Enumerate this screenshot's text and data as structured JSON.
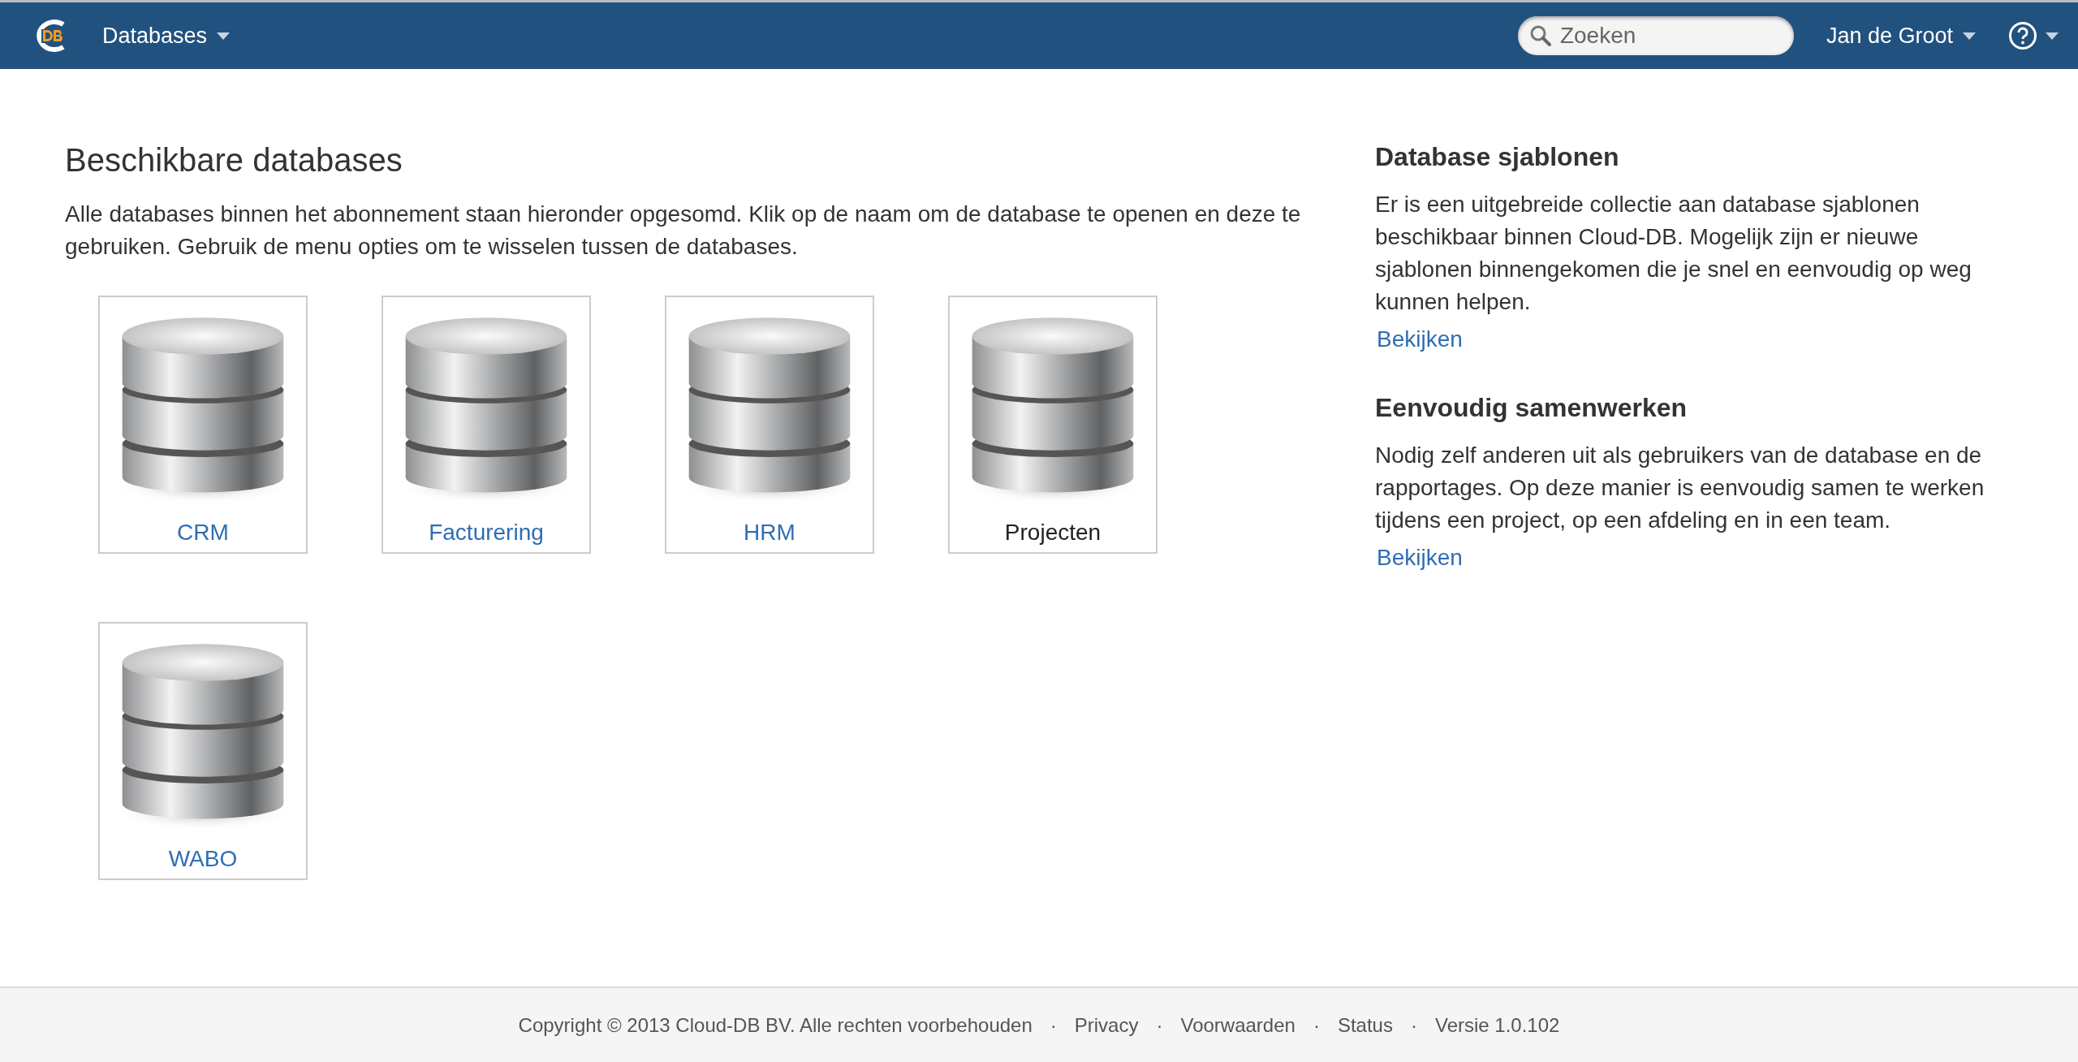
{
  "navbar": {
    "menu": "Databases",
    "search": {
      "placeholder": "Zoeken"
    },
    "user": "Jan de Groot"
  },
  "main": {
    "title": "Beschikbare databases",
    "intro": "Alle databases binnen het abonnement staan hieronder opgesomd. Klik op de naam om de database te openen en deze te gebruiken. Gebruik de menu opties om te wisselen tussen de databases.",
    "databases": [
      {
        "name": "CRM",
        "selected": false
      },
      {
        "name": "Facturering",
        "selected": false
      },
      {
        "name": "HRM",
        "selected": false
      },
      {
        "name": "Projecten",
        "selected": true
      },
      {
        "name": "WABO",
        "selected": false
      }
    ]
  },
  "sidebar": [
    {
      "title": "Database sjablonen",
      "text": "Er is een uitgebreide collectie aan database sjablonen beschikbaar binnen Cloud-DB. Mogelijk zijn er nieuwe sjablonen binnengekomen die je snel en eenvoudig op weg kunnen helpen.",
      "link": "Bekijken"
    },
    {
      "title": "Eenvoudig samenwerken",
      "text": "Nodig zelf anderen uit als gebruikers van de database en de rapportages. Op deze manier is eenvoudig samen te werken tijdens een project, op een afdeling en in een team.",
      "link": "Bekijken"
    }
  ],
  "footer": {
    "copyright": "Copyright © 2013 Cloud-DB BV. Alle rechten voorbehouden",
    "links": [
      "Privacy",
      "Voorwaarden",
      "Status"
    ],
    "separators": [
      "·",
      "·",
      "·",
      "·"
    ],
    "version": "Versie 1.0.102"
  }
}
